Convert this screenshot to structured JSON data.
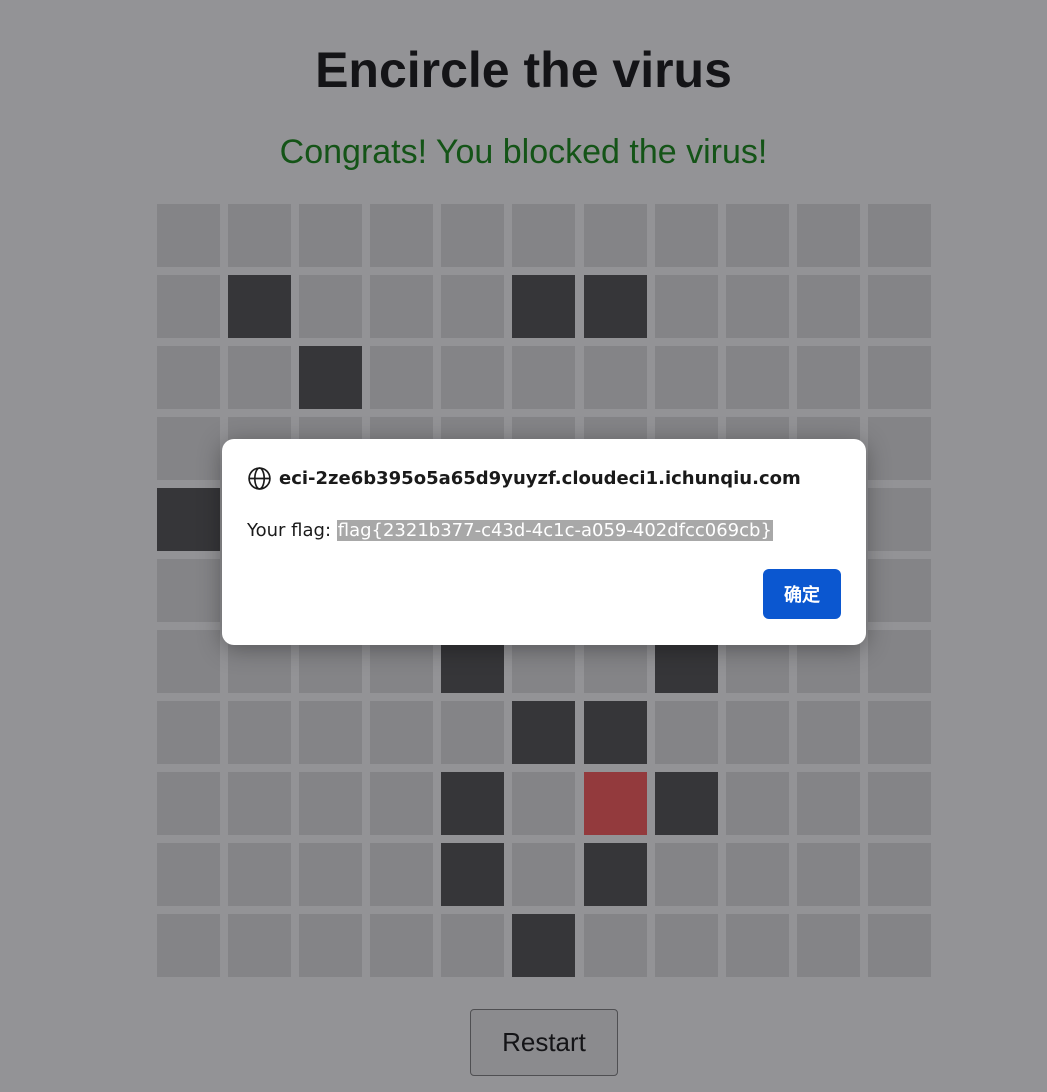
{
  "page": {
    "title": "Encircle the virus",
    "status": "Congrats! You blocked the virus!",
    "restart_label": "Restart"
  },
  "board": {
    "rows": 11,
    "cols": 11,
    "cells": [
      [
        "empty",
        "empty",
        "empty",
        "empty",
        "empty",
        "empty",
        "empty",
        "empty",
        "empty",
        "empty",
        "empty"
      ],
      [
        "empty",
        "wall",
        "empty",
        "empty",
        "empty",
        "wall",
        "wall",
        "empty",
        "empty",
        "empty",
        "empty"
      ],
      [
        "empty",
        "empty",
        "wall",
        "empty",
        "empty",
        "empty",
        "empty",
        "empty",
        "empty",
        "empty",
        "empty"
      ],
      [
        "empty",
        "empty",
        "empty",
        "empty",
        "empty",
        "empty",
        "empty",
        "empty",
        "empty",
        "empty",
        "empty"
      ],
      [
        "wall",
        "empty",
        "empty",
        "empty",
        "empty",
        "empty",
        "empty",
        "empty",
        "empty",
        "empty",
        "empty"
      ],
      [
        "empty",
        "empty",
        "empty",
        "empty",
        "empty",
        "empty",
        "empty",
        "empty",
        "empty",
        "empty",
        "empty"
      ],
      [
        "empty",
        "empty",
        "empty",
        "empty",
        "wall",
        "empty",
        "empty",
        "wall",
        "empty",
        "empty",
        "empty"
      ],
      [
        "empty",
        "empty",
        "empty",
        "empty",
        "empty",
        "wall",
        "wall",
        "empty",
        "empty",
        "empty",
        "empty"
      ],
      [
        "empty",
        "empty",
        "empty",
        "empty",
        "wall",
        "empty",
        "virus",
        "wall",
        "empty",
        "empty",
        "empty"
      ],
      [
        "empty",
        "empty",
        "empty",
        "empty",
        "wall",
        "empty",
        "wall",
        "empty",
        "empty",
        "empty",
        "empty"
      ],
      [
        "empty",
        "empty",
        "empty",
        "empty",
        "empty",
        "wall",
        "empty",
        "empty",
        "empty",
        "empty",
        "empty"
      ]
    ]
  },
  "dialog": {
    "origin": "eci-2ze6b395o5a65d9yuyzf.cloudeci1.ichunqiu.com",
    "origin_icon": "globe-icon",
    "message_label": "Your flag: ",
    "flag": "flag{2321b377-c43d-4c1c-a059-402dfcc069cb}",
    "ok_label": "确定"
  },
  "colors": {
    "status_text": "#008000",
    "wall": "#444444",
    "virus": "#ff4c4c",
    "empty": "#e0e0e0",
    "ok_button": "#0b57d0"
  }
}
